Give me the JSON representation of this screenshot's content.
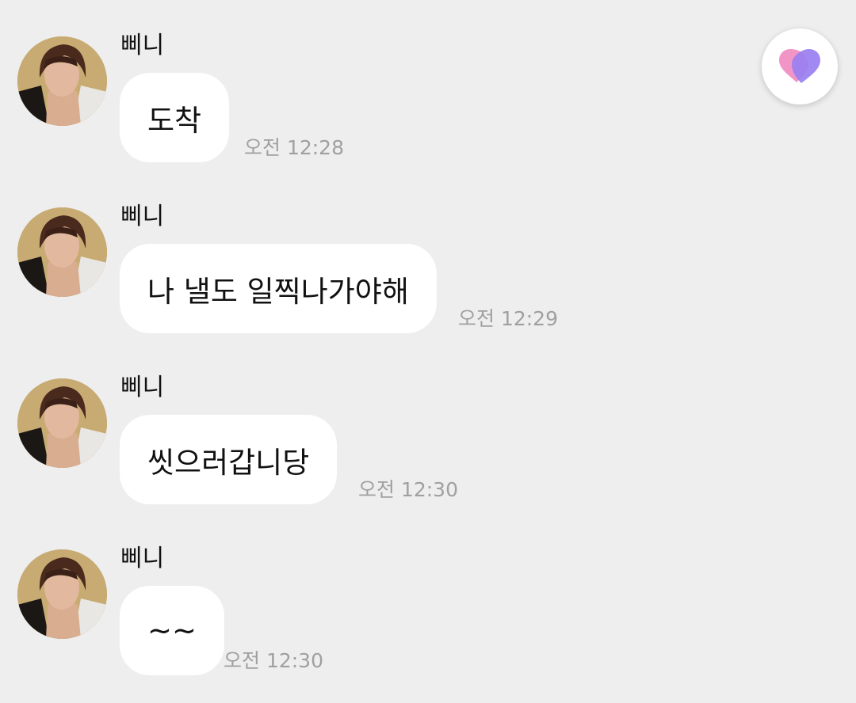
{
  "messages": [
    {
      "sender": "삐니",
      "text": "도착",
      "time": "오전 12:28"
    },
    {
      "sender": "삐니",
      "text": "나 낼도 일찍나가야해",
      "time": "오전 12:29"
    },
    {
      "sender": "삐니",
      "text": "씻으러갑니당",
      "time": "오전 12:30"
    },
    {
      "sender": "삐니",
      "text": "~~",
      "time": "오전 12:30"
    }
  ],
  "icons": {
    "avatar": "profile-photo",
    "floating_button": "heart-icon"
  },
  "colors": {
    "background": "#eeeeee",
    "bubble": "#ffffff",
    "text": "#111111",
    "timestamp": "#a0a0a0",
    "heart_pink": "#f08fc4",
    "heart_purple": "#9a7ff0"
  }
}
